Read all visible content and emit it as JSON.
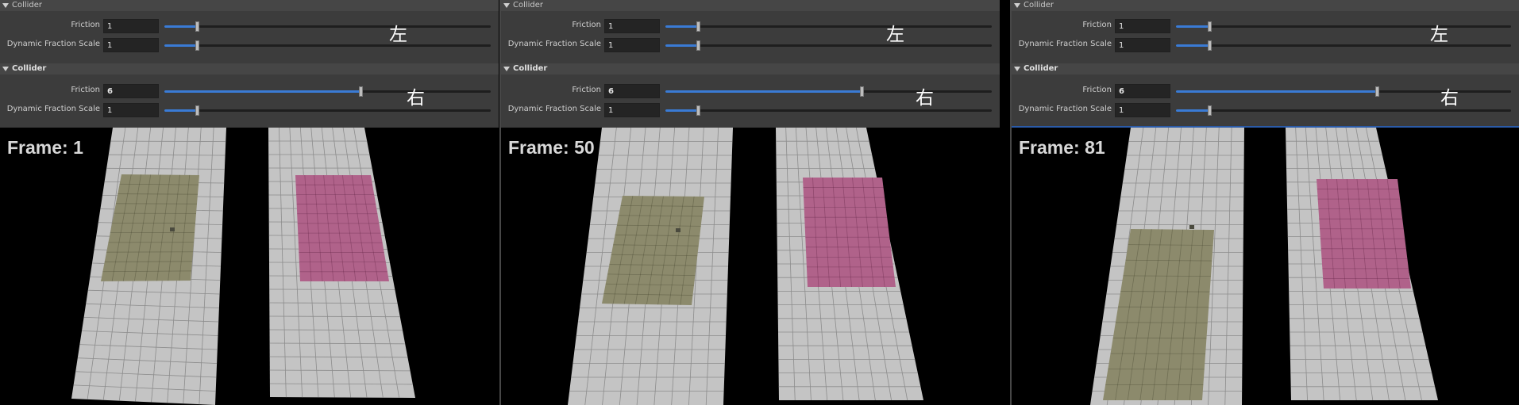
{
  "panels": [
    {
      "top_section": {
        "title": "Collider",
        "friction_label": "Friction",
        "friction_value": "1",
        "friction_slider": 0.1,
        "dfs_label": "Dynamic Fraction Scale",
        "dfs_value": "1",
        "dfs_slider": 0.1,
        "note": "左"
      },
      "bottom_section": {
        "title": "Collider",
        "friction_label": "Friction",
        "friction_value": "6",
        "friction_slider": 0.6,
        "dfs_label": "Dynamic Fraction Scale",
        "dfs_value": "1",
        "dfs_slider": 0.1,
        "note": "右"
      },
      "frame_label": "Frame: 1"
    },
    {
      "top_section": {
        "title": "Collider",
        "friction_label": "Friction",
        "friction_value": "1",
        "friction_slider": 0.1,
        "dfs_label": "Dynamic Fraction Scale",
        "dfs_value": "1",
        "dfs_slider": 0.1,
        "note": "左"
      },
      "bottom_section": {
        "title": "Collider",
        "friction_label": "Friction",
        "friction_value": "6",
        "friction_slider": 0.6,
        "dfs_label": "Dynamic Fraction Scale",
        "dfs_value": "1",
        "dfs_slider": 0.1,
        "note": "右"
      },
      "frame_label": "Frame: 50"
    },
    {
      "top_section": {
        "title": "Collider",
        "friction_label": "Friction",
        "friction_value": "1",
        "friction_slider": 0.1,
        "dfs_label": "Dynamic Fraction Scale",
        "dfs_value": "1",
        "dfs_slider": 0.1,
        "note": "左"
      },
      "bottom_section": {
        "title": "Collider",
        "friction_label": "Friction",
        "friction_value": "6",
        "friction_slider": 0.6,
        "dfs_label": "Dynamic Fraction Scale",
        "dfs_value": "1",
        "dfs_slider": 0.1,
        "note": "右"
      },
      "frame_label": "Frame: 81"
    }
  ],
  "colors": {
    "ground": "#c4c4c4",
    "grid_line": "#8c8c8c",
    "left_box": "#8c8a6c",
    "right_box": "#b0628a",
    "slider_fill": "#3a7bd5",
    "panel_bg": "#3c3c3c"
  }
}
